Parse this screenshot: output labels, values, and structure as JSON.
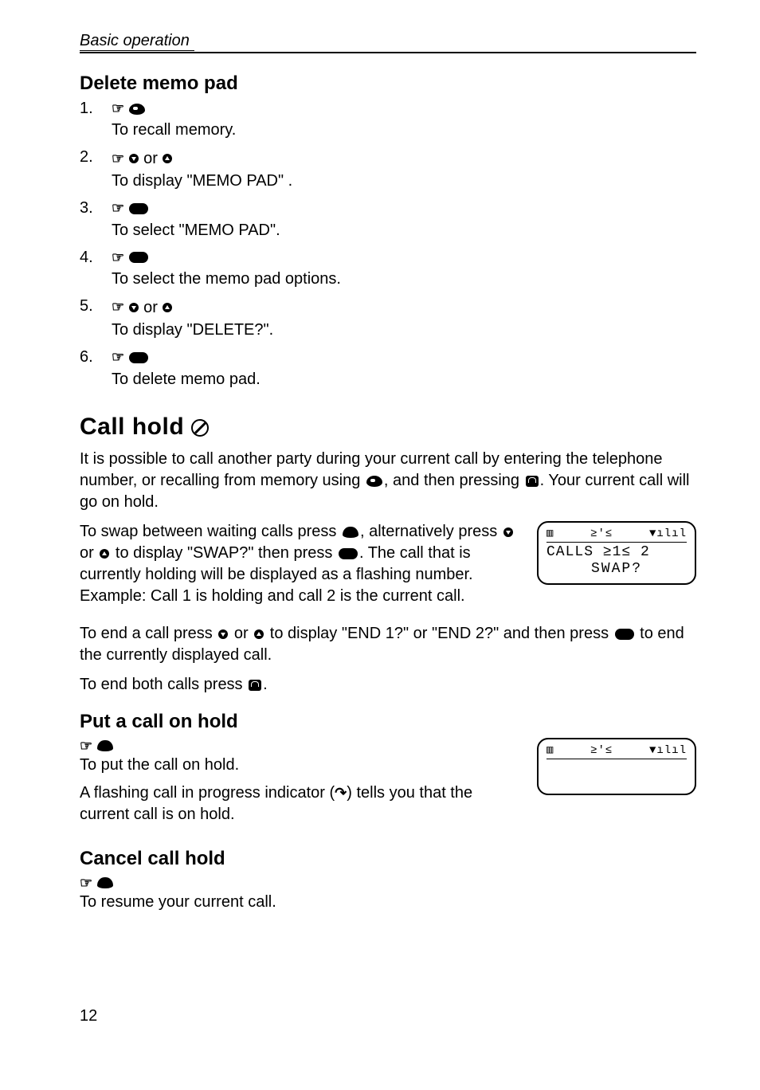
{
  "header": {
    "section": "Basic operation"
  },
  "delete_memo": {
    "title": "Delete memo pad",
    "steps": [
      {
        "desc": "To recall memory."
      },
      {
        "or": "or",
        "desc": "To display \"MEMO PAD\" ."
      },
      {
        "desc": "To select \"MEMO PAD\"."
      },
      {
        "desc": "To select the memo pad options."
      },
      {
        "or": "or",
        "desc": "To display \"DELETE?\"."
      },
      {
        "desc": "To delete memo pad."
      }
    ]
  },
  "call_hold": {
    "title": "Call hold",
    "para1a": "It is possible to call another party during your current call by entering the telephone number, or recalling from memory using ",
    "para1b": ", and then pressing ",
    "para1c": ". Your current call will go on hold.",
    "para2a": "To swap between waiting calls press ",
    "para2b": ", alternatively press ",
    "para2c": " or ",
    "para2d": " to display \"SWAP?\" then press ",
    "para2e": ". The call that is currently holding will be displayed as a flashing number. Example: Call 1 is holding and call 2 is the current call.",
    "para3a": "To end a call press ",
    "para3b": " or ",
    "para3c": " to display \"END 1?\" or \"END 2?\" and then press ",
    "para3d": " to end the currently displayed call.",
    "para4a": "To end both calls press ",
    "para4b": "."
  },
  "lcd1": {
    "status": {
      "bat": "▥",
      "mid": "≥'≤",
      "sig": "▼ılıl"
    },
    "line1": "CALLS  ≥1≤ 2",
    "line2": "SWAP?"
  },
  "put_hold": {
    "title": "Put a call on hold",
    "desc": "To put the call on hold.",
    "para": "A flashing call in progress indicator (",
    "para2": ") tells you that the current call is on hold."
  },
  "lcd2": {
    "status": {
      "bat": "▥",
      "mid": "≥'≤",
      "sig": "▼ılıl"
    }
  },
  "cancel_hold": {
    "title": "Cancel call hold",
    "desc": "To resume your current call."
  },
  "pagenum": "12"
}
